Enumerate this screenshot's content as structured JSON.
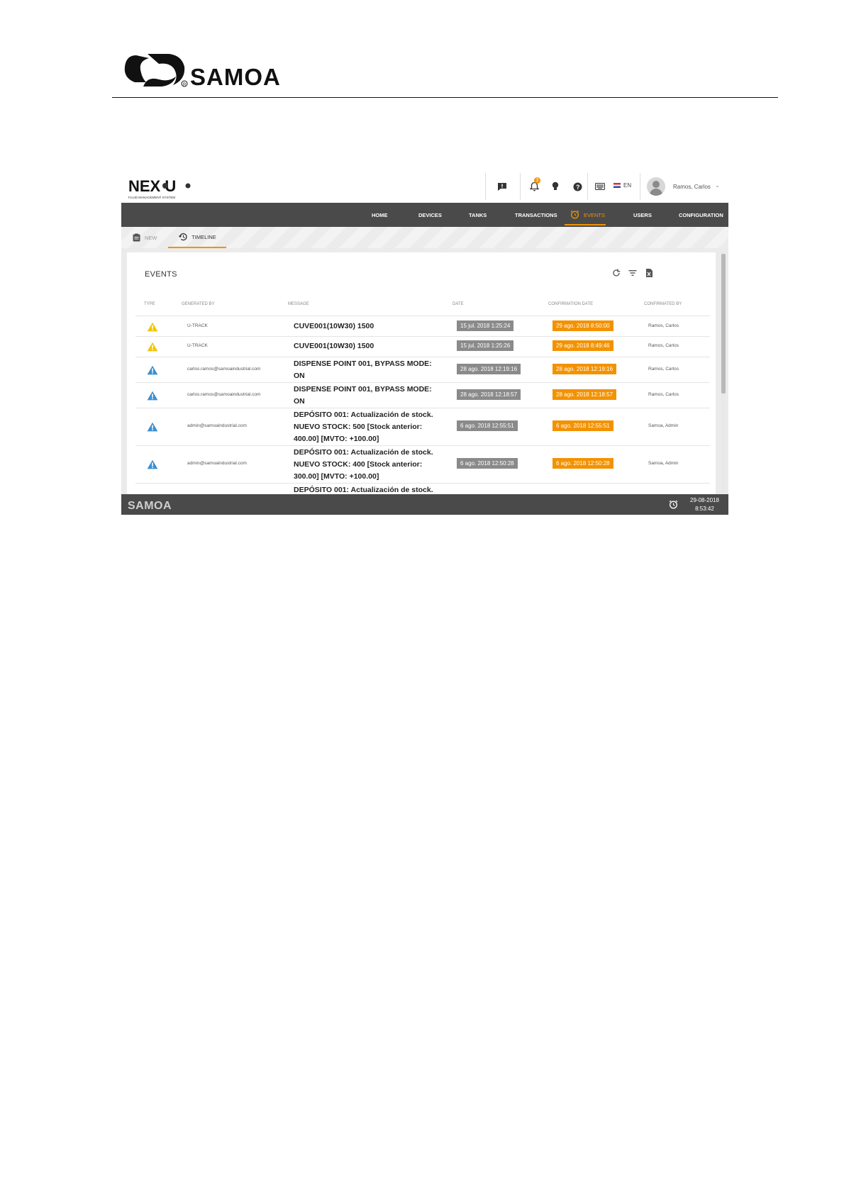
{
  "document": {
    "logo_text": "SAMOA"
  },
  "app": {
    "logo_text": "NEXU",
    "logo_tagline": "FLUID MANAGEMENT SYSTEM",
    "topbar": {
      "notification_count": "3",
      "language": "EN",
      "user_name": "Ramos, Carlos"
    },
    "nav": {
      "items": [
        "HOME",
        "DEVICES",
        "TANKS",
        "TRANSACTIONS",
        "EVENTS",
        "USERS",
        "CONFIGURATION"
      ],
      "active": "EVENTS"
    },
    "subnav": {
      "new_label": "NEW",
      "timeline_label": "TIMELINE"
    },
    "events": {
      "title": "EVENTS",
      "columns": [
        "TYPE",
        "GENERATED BY",
        "MESSAGE",
        "DATE",
        "CONFIRMATION DATE",
        "CONFIRMATED BY"
      ],
      "rows": [
        {
          "type": "warning-yellow",
          "generated_by": "U-TRACK",
          "message": [
            "CUVE001(10W30) 1500"
          ],
          "date": "15 jul. 2018 1:25:24",
          "confirmation_date": "29 ago. 2018 8:50:00",
          "confirmed_by": "Ramos, Carlos"
        },
        {
          "type": "warning-yellow",
          "generated_by": "U-TRACK",
          "message": [
            "CUVE001(10W30) 1500"
          ],
          "date": "15 jul. 2018 1:25:26",
          "confirmation_date": "29 ago. 2018 8:49:46",
          "confirmed_by": "Ramos, Carlos"
        },
        {
          "type": "warning-blue",
          "generated_by": "carlos.ramos@samoaindustrial.com",
          "message": [
            "DISPENSE POINT 001, BYPASS MODE:",
            "ON"
          ],
          "date": "28 ago. 2018 12:19:16",
          "confirmation_date": "28 ago. 2018 12:19:16",
          "confirmed_by": "Ramos, Carlos"
        },
        {
          "type": "warning-blue",
          "generated_by": "carlos.ramos@samoaindustrial.com",
          "message": [
            "DISPENSE POINT 001, BYPASS MODE:",
            "ON"
          ],
          "date": "28 ago. 2018 12:18:57",
          "confirmation_date": "28 ago. 2018 12:18:57",
          "confirmed_by": "Ramos, Carlos"
        },
        {
          "type": "warning-blue",
          "generated_by": "admin@samoaindustrial.com",
          "message": [
            "DEPÓSITO 001: Actualización de stock.",
            "NUEVO STOCK: 500 [Stock anterior:",
            "400.00] [MVTO: +100.00]"
          ],
          "date": "6 ago. 2018 12:55:51",
          "confirmation_date": "6 ago. 2018 12:55:51",
          "confirmed_by": "Samoa, Admin"
        },
        {
          "type": "warning-blue",
          "generated_by": "admin@samoaindustrial.com",
          "message": [
            "DEPÓSITO 001: Actualización de stock.",
            "NUEVO STOCK: 400 [Stock anterior:",
            "300.00] [MVTO: +100.00]"
          ],
          "date": "6 ago. 2018 12:50:28",
          "confirmation_date": "6 ago. 2018 12:50:28",
          "confirmed_by": "Samoa, Admin"
        },
        {
          "type": "",
          "generated_by": "",
          "message": [
            "DEPÓSITO 001: Actualización de stock."
          ],
          "date": "",
          "confirmation_date": "",
          "confirmed_by": ""
        }
      ]
    },
    "footer": {
      "logo_text": "SAMOA",
      "date": "29-08-2018",
      "time": "8:53:42"
    }
  },
  "colors": {
    "accent": "#f39200",
    "navbar": "#4a4a4a",
    "date_badge": "#8a8a8a",
    "warning_yellow": "#f2c500",
    "warning_blue": "#3b8fd0"
  }
}
